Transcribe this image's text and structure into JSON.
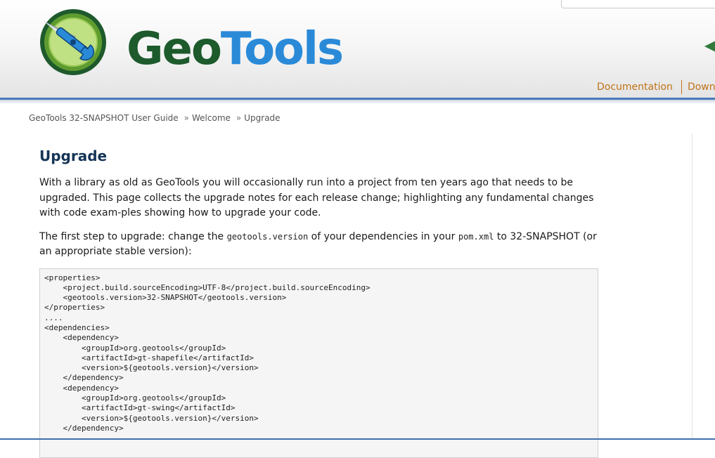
{
  "header": {
    "logo_part1": "Geo",
    "logo_part2": "Tools",
    "nav": [
      "Documentation",
      "Downlo"
    ]
  },
  "breadcrumb": {
    "items": [
      "GeoTools 32-SNAPSHOT User Guide",
      "Welcome",
      "Upgrade"
    ],
    "separator": "»"
  },
  "main": {
    "title": "Upgrade",
    "intro": "With a library as old as GeoTools you will occasionally run into a project from ten years ago that needs to be upgraded. This page collects the upgrade notes for each release change; highlighting any fundamental changes with code exam-ples showing how to upgrade your code.",
    "step_text_1": "The first step to upgrade: change the ",
    "step_code_1": "geotools.version",
    "step_text_2": " of your dependencies in your ",
    "step_code_2": "pom.xml",
    "step_text_3": " to 32-SNAPSHOT (or an appropriate stable version):",
    "code": "<properties>\n    <project.build.sourceEncoding>UTF-8</project.build.sourceEncoding>\n    <geotools.version>32-SNAPSHOT</geotools.version>\n</properties>\n....\n<dependencies>\n    <dependency>\n        <groupId>org.geotools</groupId>\n        <artifactId>gt-shapefile</artifactId>\n        <version>${geotools.version}</version>\n    </dependency>\n    <dependency>\n        <groupId>org.geotools</groupId>\n        <artifactId>gt-swing</artifactId>\n        <version>${geotools.version}</version>\n    </dependency>"
  },
  "colors": {
    "logo_green": "#1d5a2c",
    "logo_blue": "#2a8ad8",
    "nav_orange": "#c0731a",
    "title_navy": "#153556",
    "rule_blue": "#4a78b8"
  },
  "icons": [
    "compass-wrench-logo-icon",
    "partial-logo-icon"
  ]
}
